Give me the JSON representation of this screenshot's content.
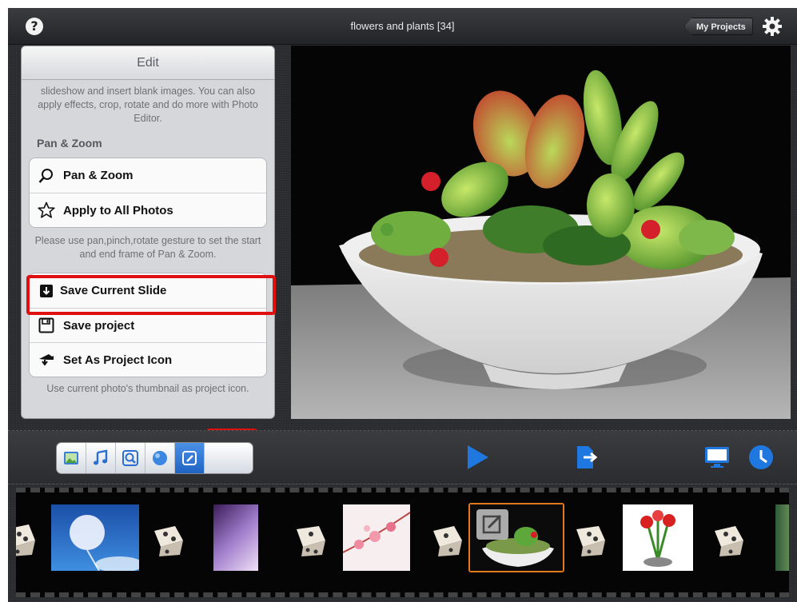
{
  "header": {
    "help_icon": "question-circle-icon",
    "title": "flowers and plants  [34]",
    "my_projects_label": "My Projects",
    "settings_icon": "gear-icon"
  },
  "edit_panel": {
    "title": "Edit",
    "description": "slideshow and insert blank images. You can also apply effects, crop, rotate and do more with Photo Editor.",
    "section_header": "Pan & Zoom",
    "pan_zoom_items": [
      {
        "label": "Pan & Zoom",
        "icon": "magnifier-icon"
      },
      {
        "label": "Apply to All Photos",
        "icon": "star-icon"
      }
    ],
    "pan_zoom_note": "Please use pan,pinch,rotate gesture to set the start and end frame of Pan & Zoom.",
    "action_items": [
      {
        "label": "Save Current Slide",
        "icon": "save-slide-icon"
      },
      {
        "label": "Save project",
        "icon": "floppy-icon"
      },
      {
        "label": "Set As Project Icon",
        "icon": "stamp-icon"
      }
    ],
    "project_icon_note": "Use current photo's thumbnail as project icon."
  },
  "toolbar": {
    "segments": [
      {
        "icon": "photo-icon",
        "active": false
      },
      {
        "icon": "music-icon",
        "active": false
      },
      {
        "icon": "zoom-icon",
        "active": false
      },
      {
        "icon": "effect-circle-icon",
        "active": false
      },
      {
        "icon": "edit-pencil-icon",
        "active": true
      }
    ],
    "play_icon": "play-icon",
    "export_icon": "export-icon",
    "display_icon": "monitor-icon",
    "duration_icon": "clock-icon"
  },
  "filmstrip": {
    "items": [
      "dice-transition",
      "dandelion-sky",
      "dice-transition",
      "purple-flowers",
      "dice-transition",
      "pink-blossoms",
      "dice-transition",
      "succulent-bowl (selected)",
      "dice-transition",
      "red-flower-arrangement",
      "dice-transition",
      "green-plant"
    ]
  },
  "colors": {
    "accent_blue": "#1e73d8",
    "highlight_red": "#e01010",
    "selected_border": "#e07a1c"
  }
}
